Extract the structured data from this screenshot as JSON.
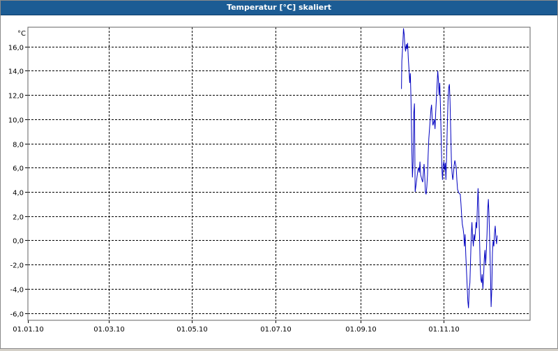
{
  "window": {
    "title": "Temperatur [°C] skaliert"
  },
  "colors": {
    "titlebar": "#1c5c94",
    "line": "#0000c0",
    "grid": "#000000",
    "background": "#ffffff"
  },
  "chart_data": {
    "type": "line",
    "title": "Temperatur [°C] skaliert",
    "ylabel": "°C",
    "xlabel": "",
    "grid": true,
    "grid_style": "dashed",
    "ylim": [
      -6.6,
      17.6
    ],
    "xlim": [
      "2010-01-01",
      "2011-01-03"
    ],
    "y_ticks": [
      16,
      14,
      12,
      10,
      8,
      6,
      4,
      2,
      0,
      -2,
      -4,
      -6
    ],
    "y_tick_labels": [
      "16,0",
      "14,0",
      "12,0",
      "10,0",
      "8,0",
      "6,0",
      "4,0",
      "2,0",
      "0,0",
      "-2,0",
      "-4,0",
      "-6,0"
    ],
    "x_ticks": [
      "2010-01-01",
      "2010-03-01",
      "2010-05-01",
      "2010-07-01",
      "2010-09-01",
      "2010-11-01"
    ],
    "x_tick_labels": [
      "01.01.10",
      "01.03.10",
      "01.05.10",
      "01.07.10",
      "01.09.10",
      "01.11.10"
    ],
    "series": [
      {
        "points": [
          [
            "2010-10-01 00:00",
            12.5
          ],
          [
            "2010-10-01 06:00",
            14.8
          ],
          [
            "2010-10-02 00:00",
            16.2
          ],
          [
            "2010-10-02 12:00",
            17.5
          ],
          [
            "2010-10-03 00:00",
            17.0
          ],
          [
            "2010-10-03 12:00",
            16.0
          ],
          [
            "2010-10-04 00:00",
            15.6
          ],
          [
            "2010-10-04 12:00",
            16.2
          ],
          [
            "2010-10-05 00:00",
            15.8
          ],
          [
            "2010-10-05 12:00",
            16.3
          ],
          [
            "2010-10-06 00:00",
            15.0
          ],
          [
            "2010-10-06 12:00",
            14.1
          ],
          [
            "2010-10-07 00:00",
            13.0
          ],
          [
            "2010-10-07 12:00",
            13.8
          ],
          [
            "2010-10-08 00:00",
            11.5
          ],
          [
            "2010-10-08 12:00",
            8.0
          ],
          [
            "2010-10-09 00:00",
            5.2
          ],
          [
            "2010-10-09 12:00",
            6.5
          ],
          [
            "2010-10-10 00:00",
            10.5
          ],
          [
            "2010-10-10 12:00",
            11.3
          ],
          [
            "2010-10-11 00:00",
            4.0
          ],
          [
            "2010-10-13 00:00",
            5.8
          ],
          [
            "2010-10-13 12:00",
            6.0
          ],
          [
            "2010-10-14 00:00",
            5.6
          ],
          [
            "2010-10-14 12:00",
            6.5
          ],
          [
            "2010-10-15 00:00",
            5.4
          ],
          [
            "2010-10-16 00:00",
            5.0
          ],
          [
            "2010-10-16 12:00",
            4.8
          ],
          [
            "2010-10-17 00:00",
            5.6
          ],
          [
            "2010-10-17 12:00",
            6.3
          ],
          [
            "2010-10-18 00:00",
            5.3
          ],
          [
            "2010-10-18 12:00",
            4.0
          ],
          [
            "2010-10-19 00:00",
            3.8
          ],
          [
            "2010-10-19 12:00",
            4.4
          ],
          [
            "2010-10-20 00:00",
            5.4
          ],
          [
            "2010-10-20 12:00",
            7.0
          ],
          [
            "2010-10-21 00:00",
            8.4
          ],
          [
            "2010-10-22 00:00",
            10.0
          ],
          [
            "2010-10-22 12:00",
            10.8
          ],
          [
            "2010-10-23 00:00",
            11.2
          ],
          [
            "2010-10-23 12:00",
            10.0
          ],
          [
            "2010-10-24 00:00",
            9.5
          ],
          [
            "2010-10-25 00:00",
            10.0
          ],
          [
            "2010-10-25 12:00",
            9.2
          ],
          [
            "2010-10-26 00:00",
            10.5
          ],
          [
            "2010-10-27 00:00",
            12.8
          ],
          [
            "2010-10-27 12:00",
            14.0
          ],
          [
            "2010-10-28 00:00",
            13.2
          ],
          [
            "2010-10-28 12:00",
            12.0
          ],
          [
            "2010-10-29 00:00",
            13.0
          ],
          [
            "2010-10-29 12:00",
            11.0
          ],
          [
            "2010-10-30 00:00",
            8.5
          ],
          [
            "2010-10-30 12:00",
            6.0
          ],
          [
            "2010-10-31 00:00",
            5.0
          ],
          [
            "2010-10-31 12:00",
            6.2
          ],
          [
            "2010-11-01 00:00",
            6.5
          ],
          [
            "2010-11-01 12:00",
            5.8
          ],
          [
            "2010-11-02 00:00",
            6.4
          ],
          [
            "2010-11-02 12:00",
            5.0
          ],
          [
            "2010-11-03 00:00",
            7.0
          ],
          [
            "2010-11-03 12:00",
            9.5
          ],
          [
            "2010-11-04 00:00",
            11.5
          ],
          [
            "2010-11-04 12:00",
            12.6
          ],
          [
            "2010-11-05 00:00",
            12.9
          ],
          [
            "2010-11-05 12:00",
            11.5
          ],
          [
            "2010-11-06 00:00",
            9.0
          ],
          [
            "2010-11-06 12:00",
            6.5
          ],
          [
            "2010-11-07 00:00",
            5.5
          ],
          [
            "2010-11-07 12:00",
            5.0
          ],
          [
            "2010-11-08 00:00",
            5.5
          ],
          [
            "2010-11-08 12:00",
            6.2
          ],
          [
            "2010-11-09 00:00",
            6.6
          ],
          [
            "2010-11-09 12:00",
            6.3
          ],
          [
            "2010-11-10 00:00",
            6.0
          ],
          [
            "2010-11-10 12:00",
            5.0
          ],
          [
            "2010-11-11 00:00",
            4.2
          ],
          [
            "2010-11-12 00:00",
            3.9
          ],
          [
            "2010-11-13 00:00",
            3.8
          ],
          [
            "2010-11-13 12:00",
            3.0
          ],
          [
            "2010-11-14 00:00",
            2.0
          ],
          [
            "2010-11-14 12:00",
            1.3
          ],
          [
            "2010-11-15 00:00",
            1.0
          ],
          [
            "2010-11-15 12:00",
            0.5
          ],
          [
            "2010-11-16 00:00",
            -0.5
          ],
          [
            "2010-11-16 12:00",
            0.5
          ],
          [
            "2010-11-17 00:00",
            -1.2
          ],
          [
            "2010-11-17 12:00",
            -2.5
          ],
          [
            "2010-11-18 00:00",
            -3.8
          ],
          [
            "2010-11-18 12:00",
            -5.0
          ],
          [
            "2010-11-19 00:00",
            -5.6
          ],
          [
            "2010-11-19 12:00",
            -4.0
          ],
          [
            "2010-11-20 00:00",
            -3.5
          ],
          [
            "2010-11-20 12:00",
            -1.5
          ],
          [
            "2010-11-21 00:00",
            0.3
          ],
          [
            "2010-11-21 12:00",
            1.5
          ],
          [
            "2010-11-22 00:00",
            0.2
          ],
          [
            "2010-11-22 12:00",
            -0.5
          ],
          [
            "2010-11-23 00:00",
            0.5
          ],
          [
            "2010-11-23 12:00",
            0.0
          ],
          [
            "2010-11-24 00:00",
            0.6
          ],
          [
            "2010-11-24 12:00",
            1.5
          ],
          [
            "2010-11-25 00:00",
            1.0
          ],
          [
            "2010-11-25 12:00",
            3.0
          ],
          [
            "2010-11-26 00:00",
            4.3
          ],
          [
            "2010-11-26 12:00",
            2.5
          ],
          [
            "2010-11-27 00:00",
            0.5
          ],
          [
            "2010-11-27 12:00",
            -2.0
          ],
          [
            "2010-11-28 00:00",
            -3.2
          ],
          [
            "2010-11-28 12:00",
            -3.5
          ],
          [
            "2010-11-29 00:00",
            -2.8
          ],
          [
            "2010-11-29 12:00",
            -4.0
          ],
          [
            "2010-11-30 00:00",
            -3.0
          ],
          [
            "2010-11-30 12:00",
            -1.5
          ],
          [
            "2010-12-01 00:00",
            -0.8
          ],
          [
            "2010-12-01 12:00",
            -2.0
          ],
          [
            "2010-12-02 00:00",
            -1.0
          ],
          [
            "2010-12-02 12:00",
            0.5
          ],
          [
            "2010-12-03 00:00",
            2.5
          ],
          [
            "2010-12-03 12:00",
            3.4
          ],
          [
            "2010-12-04 00:00",
            2.0
          ],
          [
            "2010-12-04 12:00",
            0.0
          ],
          [
            "2010-12-05 00:00",
            -2.5
          ],
          [
            "2010-12-05 12:00",
            -5.5
          ],
          [
            "2010-12-06 00:00",
            -4.0
          ],
          [
            "2010-12-06 12:00",
            -1.0
          ],
          [
            "2010-12-07 00:00",
            0.0
          ],
          [
            "2010-12-07 12:00",
            -0.5
          ],
          [
            "2010-12-08 00:00",
            0.6
          ],
          [
            "2010-12-08 12:00",
            1.2
          ],
          [
            "2010-12-09 00:00",
            0.2
          ],
          [
            "2010-12-09 12:00",
            -0.3
          ],
          [
            "2010-12-10 00:00",
            0.4
          ]
        ]
      }
    ]
  }
}
